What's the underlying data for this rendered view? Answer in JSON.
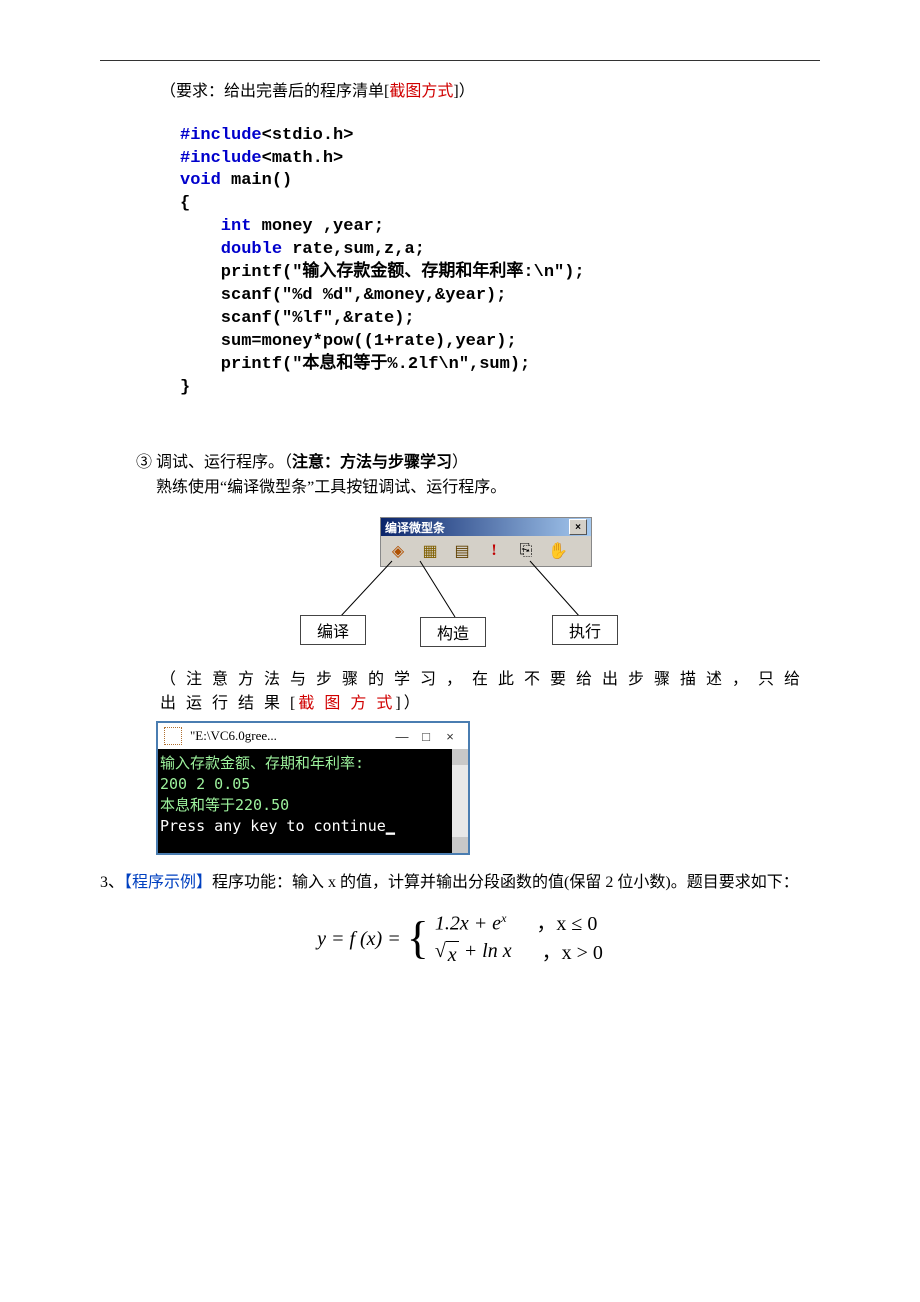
{
  "hr": true,
  "req_line": {
    "prefix": "（要求：给出完善后的程序清单[",
    "highlight": "截图方式",
    "suffix": "]）"
  },
  "code": {
    "l1a": "#include",
    "l1b": "<stdio.h>",
    "l2a": "#include",
    "l2b": "<math.h>",
    "l3a": "void",
    "l3b": " main()",
    "l4": "{",
    "l5a": "    int",
    "l5b": " money ,year;",
    "l6a": "    double",
    "l6b": " rate,sum,z,a;",
    "l7": "    printf(\"输入存款金额、存期和年利率:\\n\");",
    "l8": "    scanf(\"%d %d\",&money,&year);",
    "l9": "    scanf(\"%lf\",&rate);",
    "l10": "    sum=money*pow((1+rate),year);",
    "l11": "    printf(\"本息和等于%.2lf\\n\",sum);",
    "l12": "}"
  },
  "step3": {
    "heading": "③ 调试、运行程序。（",
    "heading_bold": "注意：方法与步骤学习",
    "heading_suffix": "）",
    "desc": "熟练使用“编译微型条”工具按钮调试、运行程序。"
  },
  "toolbar": {
    "title": "编译微型条",
    "close": "×",
    "callouts": {
      "compile": "编译",
      "build": "构造",
      "run": "执行"
    }
  },
  "note2": {
    "prefix": "（ 注 意 方 法 与 步 骤 的 学 习 ， 在 此 不 要 给 出 步 骤 描 述 ， 只 给 出 运 行 结 果 [",
    "highlight": "截 图 方 式",
    "suffix": "]）"
  },
  "console": {
    "title": "\"E:\\VC6.0gree...",
    "min": "—",
    "max": "□",
    "close": "×",
    "line1": "输入存款金额、存期和年利率:",
    "line2": "200 2  0.05",
    "line3": "本息和等于220.50",
    "line4": "Press any key to continue"
  },
  "para3": {
    "num": "3、",
    "tag": "【程序示例】",
    "body": "程序功能：输入 x 的值，计算并输出分段函数的值(保留 2 位小数)。题目要求如下："
  },
  "equation": {
    "lhs": "y = f (x) = ",
    "case1_expr_a": "1.2x + e",
    "case1_expr_sup": "x",
    "case1_cond": "，x ≤ 0",
    "case2_sqrt_arg": "x",
    "case2_rest": " + ln x",
    "case2_cond": "，x > 0"
  }
}
